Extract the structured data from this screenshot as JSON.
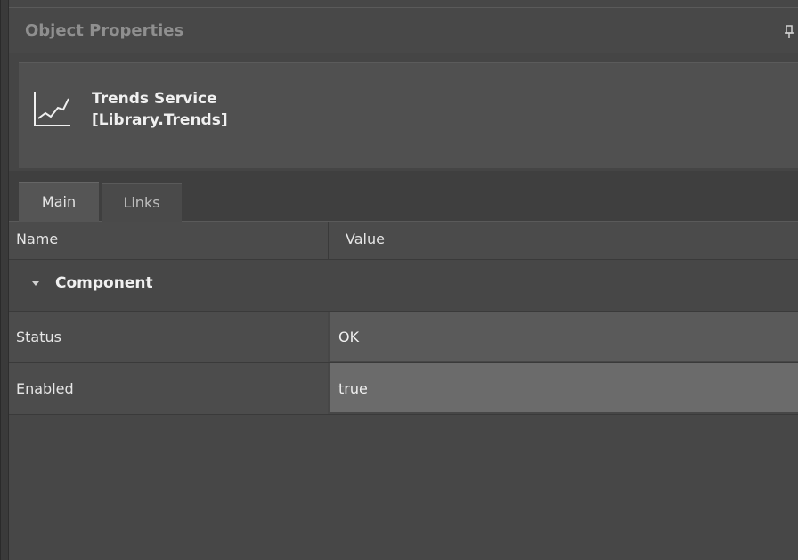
{
  "panel": {
    "title": "Object Properties"
  },
  "object": {
    "name": "Trends Service",
    "type": "[Library.Trends]"
  },
  "tabs": [
    {
      "label": "Main",
      "active": true
    },
    {
      "label": "Links",
      "active": false
    }
  ],
  "grid": {
    "columns": {
      "name": "Name",
      "value": "Value"
    },
    "group": "Component",
    "rows": [
      {
        "name": "Status",
        "value": "OK"
      },
      {
        "name": "Enabled",
        "value": "true"
      }
    ]
  }
}
